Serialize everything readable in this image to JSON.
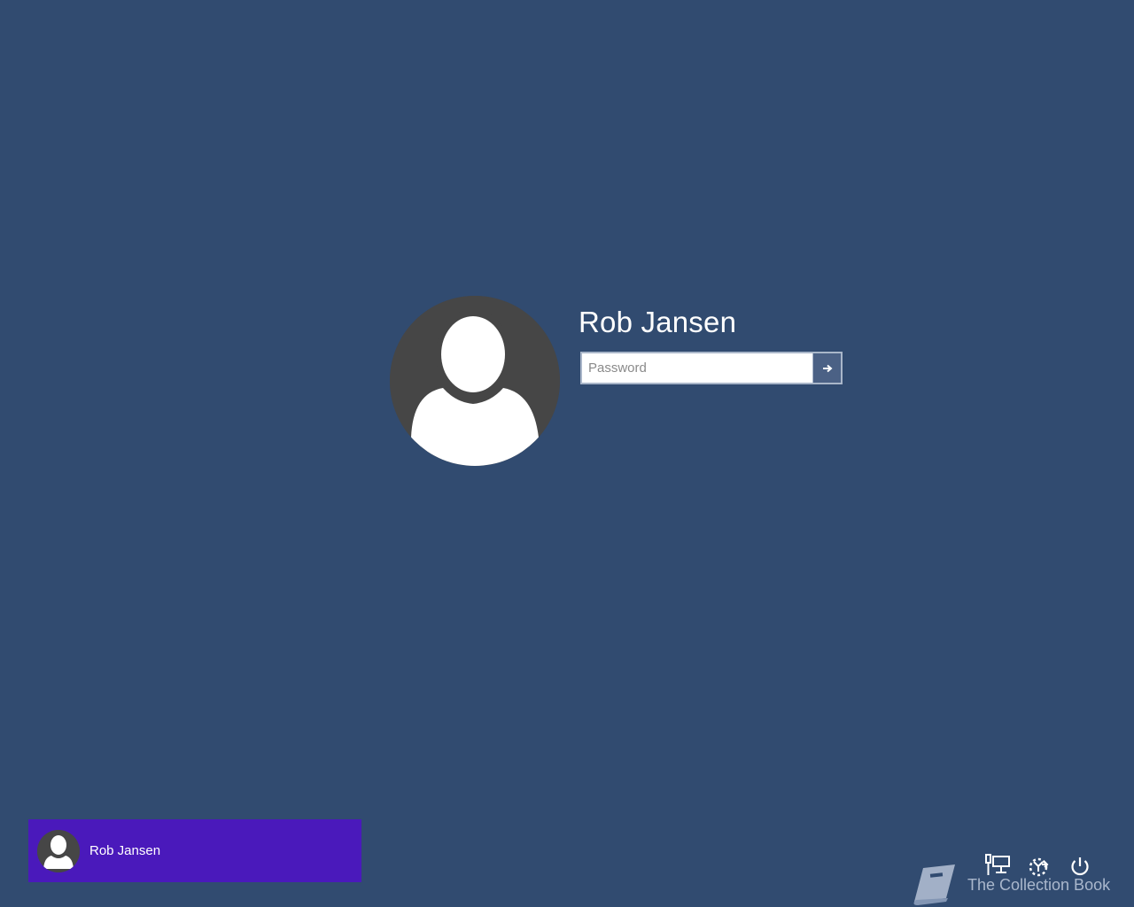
{
  "login": {
    "user_name": "Rob Jansen",
    "password_placeholder": "Password",
    "password_value": "",
    "submit_icon": "arrow-right-icon"
  },
  "user_list": [
    {
      "name": "Rob Jansen",
      "avatar_icon": "user-silhouette-icon",
      "selected": true
    }
  ],
  "system_icons": [
    {
      "name": "network-icon"
    },
    {
      "name": "ease-of-access-icon"
    },
    {
      "name": "power-icon"
    }
  ],
  "watermark": {
    "text": "The Collection Book",
    "logo_icon": "book-icon"
  },
  "colors": {
    "background": "#314b70",
    "avatar_bg": "#464646",
    "user_tile_selected": "#4a19bb",
    "submit_button": "#4b6185"
  }
}
